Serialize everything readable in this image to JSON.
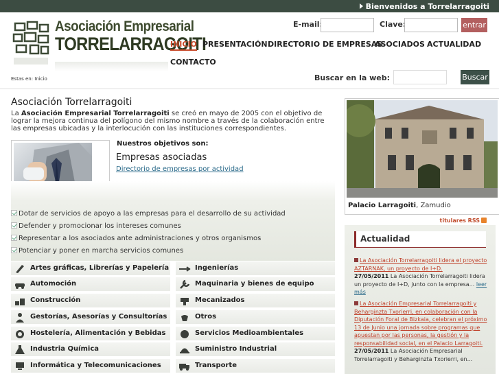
{
  "topbar": {
    "welcome": "Bienvenidos a Torrelarragoiti"
  },
  "logo": {
    "line1": "Asociación Empresarial",
    "line2": "TORRELARRAGOITI"
  },
  "login": {
    "email_label": "E-mail:",
    "email_value": "",
    "password_label": "Clave:",
    "password_value": "",
    "enter_label": "entrar"
  },
  "nav": {
    "items": [
      "INICIO",
      "PRESENTACIÓN",
      "DIRECTORIO DE EMPRESAS",
      "ASOCIADOS",
      "ACTUALIDAD",
      "CONTACTO"
    ]
  },
  "breadcrumb": "Estas en: Inicio",
  "search": {
    "label": "Buscar en la web:",
    "value": "",
    "button": "Buscar"
  },
  "main": {
    "title": "Asociación Torrelarragoiti",
    "intro_prefix": "La ",
    "intro_bold": "Asociación Empresarial Torrelarragoiti",
    "intro_rest": " se creó en mayo de 2005 con el objetivo de lograr la mejora continua del polígono del mismo nombre a través de la colaboración entre las empresas ubicadas y la interlocución con las instituciones correspondientes.",
    "objectives_label": "Nuestros objetivos son:",
    "associated_heading": "Empresas asociadas",
    "directory_link": "Directorio de empresas por actividad",
    "objectives": [
      "Dotar de servicios de apoyo a las empresas para el desarrollo de su actividad",
      "Defender y promocionar los intereses comunes",
      "Representar a los asociados ante administraciones y otros organismos",
      "Potenciar y poner en marcha servicios comunes"
    ],
    "sectors_left": [
      "Artes gráficas, Librerías y Papelería",
      "Automoción",
      "Construcción",
      "Gestorías, Asesorías y Consultorías",
      "Hostelería, Alimentación y Bebidas",
      "Industria Química",
      "Informática y Telecomunicaciones"
    ],
    "sectors_right": [
      "Ingenierías",
      "Maquinaria y bienes de equipo",
      "Mecanizados",
      "Otros",
      "Servicios Medioambientales",
      "Suministro Industrial",
      "Transporte"
    ]
  },
  "right": {
    "caption_bold": "Palacio Larragoiti",
    "caption_rest": ", Zamudio",
    "rss": "titulares RSS",
    "news_title": "Actualidad",
    "news": [
      {
        "headline": "La Asociación Torrelarragoiti lidera el proyecto AZTARNAK, un proyecto de I+D.",
        "date": "27/05/2011",
        "summary": " La Asociación Torrelarragoiti lidera un proyecto de I+D, junto con la empresa... ",
        "more": "leer más"
      },
      {
        "headline": "La Asociación Empresarial Torrelarragoiti y Beharginzta Txorierri, en colaboración con la Diputación Foral de Bizkaia, celebran el próximo 13 de Junio una jornada sobre programas que apuestan por las personas, la gestión y la responsabilidad social, en el Palacio Larragoiti.",
        "date": "27/05/2011",
        "summary": " La Asociación Empresarial Torrelarragoiti y Beharginzta Txorierri, en...",
        "more": ""
      }
    ]
  }
}
